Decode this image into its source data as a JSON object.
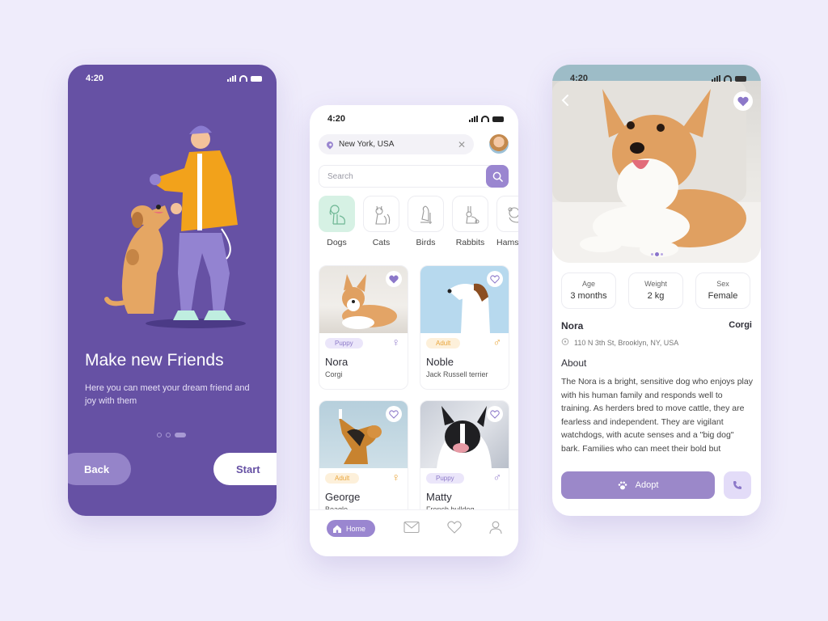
{
  "colors": {
    "background": "#efecfb",
    "primary_purple": "#6651a4",
    "accent_purple": "#9a86d0",
    "soft_purple": "#e3dcf8",
    "mint": "#d6f1e4",
    "orange": "#e9a63d"
  },
  "onboarding": {
    "status_time": "4:20",
    "title": "Make new Friends",
    "subtitle": "Here you can meet your dream friend and joy with them",
    "pager": {
      "total": 3,
      "active": 3
    },
    "back_label": "Back",
    "start_label": "Start",
    "illustration": "man-playing-with-dog"
  },
  "home": {
    "status_time": "4:20",
    "location": "New York, USA",
    "search_placeholder": "Search",
    "categories": [
      {
        "label": "Dogs",
        "icon": "dog-icon",
        "selected": true
      },
      {
        "label": "Cats",
        "icon": "cat-icon",
        "selected": false
      },
      {
        "label": "Birds",
        "icon": "bird-icon",
        "selected": false
      },
      {
        "label": "Rabbits",
        "icon": "rabbit-icon",
        "selected": false
      },
      {
        "label": "Hamsters",
        "icon": "hamster-icon",
        "selected": false
      }
    ],
    "pets": [
      {
        "name": "Nora",
        "breed": "Corgi",
        "age_badge": "Puppy",
        "sex": "female",
        "sex_symbol": "♀",
        "favorite": true
      },
      {
        "name": "Noble",
        "breed": "Jack Russell terrier",
        "age_badge": "Adult",
        "sex": "male",
        "sex_symbol": "♂",
        "favorite": false
      },
      {
        "name": "George",
        "breed": "Beagle",
        "age_badge": "Adult",
        "sex": "female",
        "sex_symbol": "♀",
        "favorite": false
      },
      {
        "name": "Matty",
        "breed": "French bulldog",
        "age_badge": "Puppy",
        "sex": "male",
        "sex_symbol": "♂",
        "favorite": false
      }
    ],
    "tabbar": {
      "home_label": "Home",
      "items": [
        "home",
        "messages",
        "favorites",
        "profile"
      ]
    }
  },
  "detail": {
    "status_time": "4:20",
    "favorite": true,
    "photo_pager": {
      "total": 3,
      "active": 2
    },
    "stats": [
      {
        "key": "Age",
        "value": "3 months"
      },
      {
        "key": "Weight",
        "value": "2 kg"
      },
      {
        "key": "Sex",
        "value": "Female"
      }
    ],
    "name": "Nora",
    "breed": "Corgi",
    "address": "110 N 3th St, Brooklyn, NY, USA",
    "about_heading": "About",
    "about_text": "The Nora is a bright, sensitive dog who enjoys play with his human family and responds well to training. As herders bred to move cattle, they are fearless and independent. They are vigilant watchdogs, with acute senses and a \"big dog\" bark. Families who can meet their bold but",
    "adopt_label": "Adopt"
  }
}
